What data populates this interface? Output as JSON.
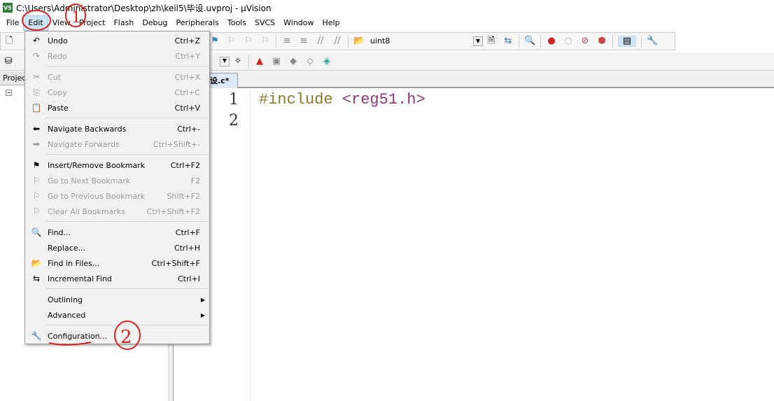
{
  "window": {
    "title": "C:\\Users\\Administrator\\Desktop\\zh\\keil5\\毕设.uvproj - µVision",
    "app_icon": "V5"
  },
  "menubar": [
    "File",
    "Edit",
    "View",
    "Project",
    "Flash",
    "Debug",
    "Peripherals",
    "Tools",
    "SVCS",
    "Window",
    "Help"
  ],
  "toolbar": {
    "target_combo": "uint8"
  },
  "project_panel": {
    "title": "Project"
  },
  "editor": {
    "tab": "毕设.c*",
    "lines": [
      {
        "num": "1",
        "directive": "#include",
        "arg": "<reg51.h>"
      },
      {
        "num": "2",
        "directive": "",
        "arg": ""
      }
    ]
  },
  "edit_menu": {
    "groups": [
      [
        {
          "label": "Undo",
          "shortcut": "Ctrl+Z",
          "icon": "undo-icon",
          "enabled": true,
          "glyph": "↶"
        },
        {
          "label": "Redo",
          "shortcut": "Ctrl+Y",
          "icon": "redo-icon",
          "enabled": false,
          "glyph": "↷"
        }
      ],
      [
        {
          "label": "Cut",
          "shortcut": "Ctrl+X",
          "icon": "cut-icon",
          "enabled": false,
          "glyph": "✂"
        },
        {
          "label": "Copy",
          "shortcut": "Ctrl+C",
          "icon": "copy-icon",
          "enabled": false,
          "glyph": "⎘"
        },
        {
          "label": "Paste",
          "shortcut": "Ctrl+V",
          "icon": "paste-icon",
          "enabled": true,
          "glyph": "📋"
        }
      ],
      [
        {
          "label": "Navigate Backwards",
          "shortcut": "Ctrl+-",
          "icon": "arrow-left-icon",
          "enabled": true,
          "glyph": "⬅"
        },
        {
          "label": "Navigate Forwards",
          "shortcut": "Ctrl+Shift+-",
          "icon": "arrow-right-icon",
          "enabled": false,
          "glyph": "➡"
        }
      ],
      [
        {
          "label": "Insert/Remove Bookmark",
          "shortcut": "Ctrl+F2",
          "icon": "bookmark-icon",
          "enabled": true,
          "glyph": "⚑"
        },
        {
          "label": "Go to Next Bookmark",
          "shortcut": "F2",
          "icon": "next-bookmark-icon",
          "enabled": false,
          "glyph": "⚐"
        },
        {
          "label": "Go to Previous Bookmark",
          "shortcut": "Shift+F2",
          "icon": "prev-bookmark-icon",
          "enabled": false,
          "glyph": "⚐"
        },
        {
          "label": "Clear All Bookmarks",
          "shortcut": "Ctrl+Shift+F2",
          "icon": "clear-bookmarks-icon",
          "enabled": false,
          "glyph": "⚐"
        }
      ],
      [
        {
          "label": "Find...",
          "shortcut": "Ctrl+F",
          "icon": "find-icon",
          "enabled": true,
          "glyph": "🔍"
        },
        {
          "label": "Replace...",
          "shortcut": "Ctrl+H",
          "icon": "",
          "enabled": true,
          "glyph": ""
        },
        {
          "label": "Find in Files...",
          "shortcut": "Ctrl+Shift+F",
          "icon": "find-in-files-icon",
          "enabled": true,
          "glyph": "📂"
        },
        {
          "label": "Incremental Find",
          "shortcut": "Ctrl+I",
          "icon": "incremental-find-icon",
          "enabled": true,
          "glyph": "⇆"
        }
      ],
      [
        {
          "label": "Outlining",
          "shortcut": "",
          "icon": "",
          "enabled": true,
          "submenu": true,
          "glyph": ""
        },
        {
          "label": "Advanced",
          "shortcut": "",
          "icon": "",
          "enabled": true,
          "submenu": true,
          "glyph": ""
        }
      ],
      [
        {
          "label": "Configuration...",
          "shortcut": "",
          "icon": "wrench-icon",
          "enabled": true,
          "glyph": "🔧"
        }
      ]
    ]
  },
  "annotations": {
    "first": "1",
    "second": "2",
    "color": "#e02020"
  }
}
